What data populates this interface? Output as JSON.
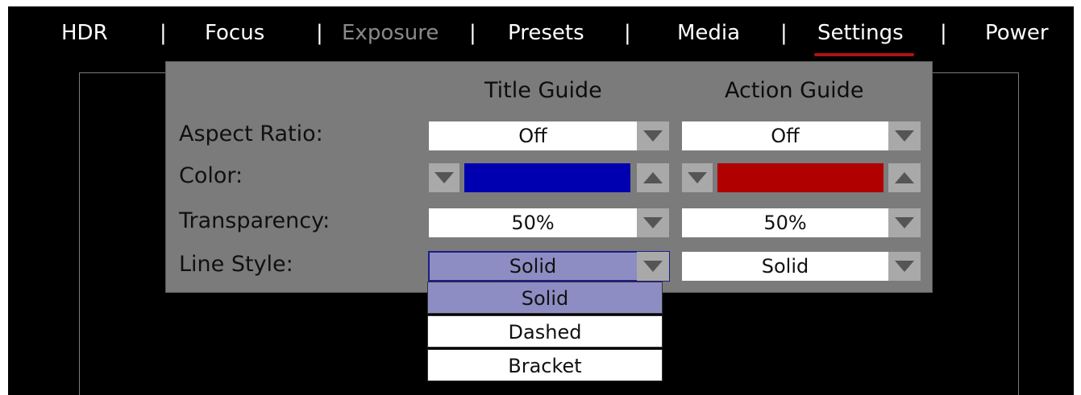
{
  "tabs": [
    {
      "label": "HDR",
      "state": "normal"
    },
    {
      "label": "Focus",
      "state": "normal"
    },
    {
      "label": "Exposure",
      "state": "disabled"
    },
    {
      "label": "Presets",
      "state": "normal"
    },
    {
      "label": "Media",
      "state": "normal"
    },
    {
      "label": "Settings",
      "state": "active"
    },
    {
      "label": "Power",
      "state": "normal"
    }
  ],
  "separator": "|",
  "panel": {
    "columns": {
      "title_guide": "Title Guide",
      "action_guide": "Action Guide"
    },
    "rows": {
      "aspect_ratio": {
        "label": "Aspect Ratio:",
        "title_value": "Off",
        "action_value": "Off"
      },
      "color": {
        "label": "Color:",
        "title_color": "#0000b0",
        "action_color": "#b00000"
      },
      "transparency": {
        "label": "Transparency:",
        "title_value": "50%",
        "action_value": "50%"
      },
      "line_style": {
        "label": "Line Style:",
        "title_value": "Solid",
        "action_value": "Solid"
      }
    }
  },
  "dropdown": {
    "options": [
      "Solid",
      "Dashed",
      "Bracket"
    ],
    "selected": "Solid"
  },
  "colors": {
    "accent_underline": "#b11212",
    "focus_fill": "#8d8dc3",
    "focus_border": "#1c1c88"
  }
}
